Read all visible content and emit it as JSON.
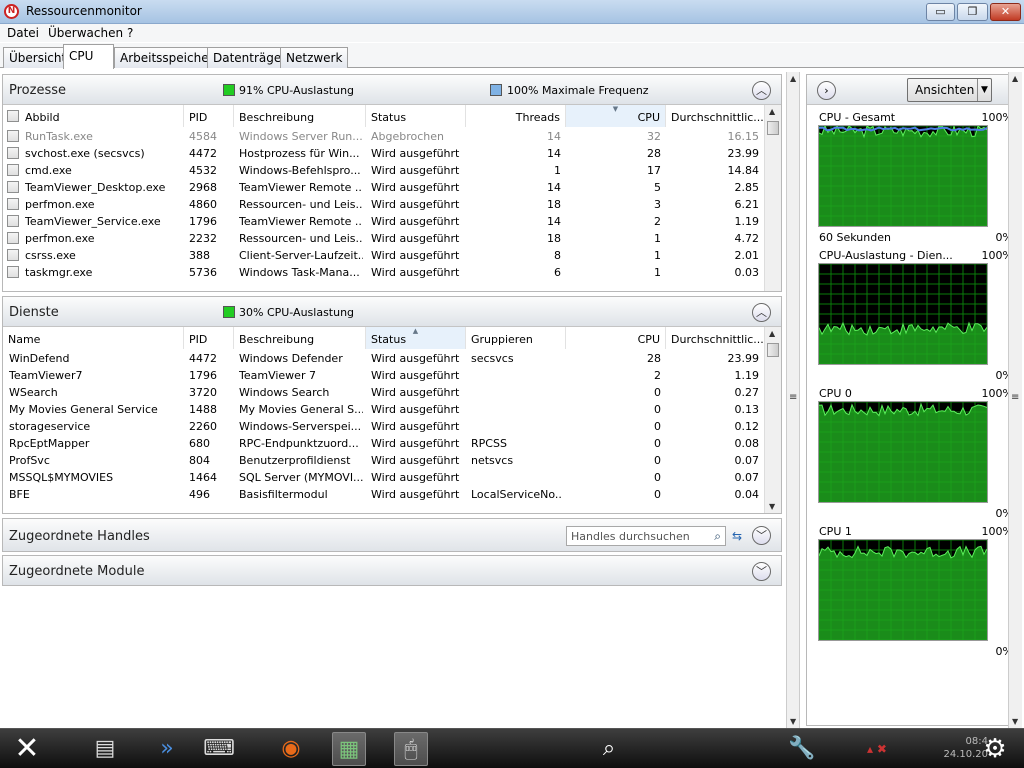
{
  "window": {
    "title": "Ressourcenmonitor",
    "minimize": "▭",
    "restore": "❐",
    "close": "✕"
  },
  "menu": [
    "Datei",
    "Überwachen",
    "?"
  ],
  "tabs": [
    "Übersicht",
    "CPU",
    "Arbeitsspeicher",
    "Datenträger",
    "Netzwerk"
  ],
  "prozesse": {
    "title": "Prozesse",
    "legend1": "91% CPU-Auslastung",
    "legend1_color": "#22cc22",
    "legend2": "100% Maximale Frequenz",
    "legend2_color": "#7fb2e5",
    "columns": [
      "Abbild",
      "PID",
      "Beschreibung",
      "Status",
      "Threads",
      "CPU",
      "Durchschnittlic..."
    ],
    "rows": [
      {
        "name": "RunTask.exe",
        "pid": "4584",
        "desc": "Windows Server Run...",
        "status": "Abgebrochen",
        "threads": "14",
        "cpu": "32",
        "avg": "16.15"
      },
      {
        "name": "svchost.exe (secsvcs)",
        "pid": "4472",
        "desc": "Hostprozess für Win...",
        "status": "Wird ausgeführt",
        "threads": "14",
        "cpu": "28",
        "avg": "23.99"
      },
      {
        "name": "cmd.exe",
        "pid": "4532",
        "desc": "Windows-Befehlspro...",
        "status": "Wird ausgeführt",
        "threads": "1",
        "cpu": "17",
        "avg": "14.84"
      },
      {
        "name": "TeamViewer_Desktop.exe",
        "pid": "2968",
        "desc": "TeamViewer Remote ...",
        "status": "Wird ausgeführt",
        "threads": "14",
        "cpu": "5",
        "avg": "2.85"
      },
      {
        "name": "perfmon.exe",
        "pid": "4860",
        "desc": "Ressourcen- und Leis...",
        "status": "Wird ausgeführt",
        "threads": "18",
        "cpu": "3",
        "avg": "6.21"
      },
      {
        "name": "TeamViewer_Service.exe",
        "pid": "1796",
        "desc": "TeamViewer Remote ...",
        "status": "Wird ausgeführt",
        "threads": "14",
        "cpu": "2",
        "avg": "1.19"
      },
      {
        "name": "perfmon.exe",
        "pid": "2232",
        "desc": "Ressourcen- und Leis...",
        "status": "Wird ausgeführt",
        "threads": "18",
        "cpu": "1",
        "avg": "4.72"
      },
      {
        "name": "csrss.exe",
        "pid": "388",
        "desc": "Client-Server-Laufzeit...",
        "status": "Wird ausgeführt",
        "threads": "8",
        "cpu": "1",
        "avg": "2.01"
      },
      {
        "name": "taskmgr.exe",
        "pid": "5736",
        "desc": "Windows Task-Mana...",
        "status": "Wird ausgeführt",
        "threads": "6",
        "cpu": "1",
        "avg": "0.03"
      }
    ]
  },
  "dienste": {
    "title": "Dienste",
    "legend1": "30% CPU-Auslastung",
    "legend1_color": "#22cc22",
    "columns": [
      "Name",
      "PID",
      "Beschreibung",
      "Status",
      "Gruppieren",
      "CPU",
      "Durchschnittlic..."
    ],
    "rows": [
      {
        "name": "WinDefend",
        "pid": "4472",
        "desc": "Windows Defender",
        "status": "Wird ausgeführt",
        "group": "secsvcs",
        "cpu": "28",
        "avg": "23.99"
      },
      {
        "name": "TeamViewer7",
        "pid": "1796",
        "desc": "TeamViewer 7",
        "status": "Wird ausgeführt",
        "group": "",
        "cpu": "2",
        "avg": "1.19"
      },
      {
        "name": "WSearch",
        "pid": "3720",
        "desc": "Windows Search",
        "status": "Wird ausgeführt",
        "group": "",
        "cpu": "0",
        "avg": "0.27"
      },
      {
        "name": "My Movies General Service",
        "pid": "1488",
        "desc": "My Movies General S...",
        "status": "Wird ausgeführt",
        "group": "",
        "cpu": "0",
        "avg": "0.13"
      },
      {
        "name": "storageservice",
        "pid": "2260",
        "desc": "Windows-Serverspei...",
        "status": "Wird ausgeführt",
        "group": "",
        "cpu": "0",
        "avg": "0.12"
      },
      {
        "name": "RpcEptMapper",
        "pid": "680",
        "desc": "RPC-Endpunktzuord...",
        "status": "Wird ausgeführt",
        "group": "RPCSS",
        "cpu": "0",
        "avg": "0.08"
      },
      {
        "name": "ProfSvc",
        "pid": "804",
        "desc": "Benutzerprofildienst",
        "status": "Wird ausgeführt",
        "group": "netsvcs",
        "cpu": "0",
        "avg": "0.07"
      },
      {
        "name": "MSSQL$MYMOVIES",
        "pid": "1464",
        "desc": "SQL Server (MYMOVI...",
        "status": "Wird ausgeführt",
        "group": "",
        "cpu": "0",
        "avg": "0.07"
      },
      {
        "name": "BFE",
        "pid": "496",
        "desc": "Basisfiltermodul",
        "status": "Wird ausgeführt",
        "group": "LocalServiceNo...",
        "cpu": "0",
        "avg": "0.04"
      }
    ]
  },
  "handles": {
    "title": "Zugeordnete Handles",
    "search_placeholder": "Handles durchsuchen"
  },
  "module": {
    "title": "Zugeordnete Module"
  },
  "right_panel": {
    "view_button": "Ansichten",
    "graphs": [
      {
        "label": "CPU - Gesamt",
        "top_pct": "100%",
        "footer": "60 Sekunden",
        "bottom_pct": "0%",
        "level": 0.95,
        "secondary_level": 0.97
      },
      {
        "label": "CPU-Auslastung - Dien...",
        "top_pct": "100%",
        "footer": "",
        "bottom_pct": "0%",
        "level": 0.35,
        "secondary_level": null
      },
      {
        "label": "CPU 0",
        "top_pct": "100%",
        "footer": "",
        "bottom_pct": "0%",
        "level": 0.92,
        "secondary_level": null
      },
      {
        "label": "CPU 1",
        "top_pct": "100%",
        "footer": "",
        "bottom_pct": "0%",
        "level": 0.88,
        "secondary_level": null
      }
    ]
  },
  "taskbar": {
    "icons": [
      "close-icon",
      "server-manager-icon",
      "powershell-icon",
      "keyboard-icon",
      "firefox-icon",
      "network-icon",
      "mouse-icon",
      "search-icon",
      "tools-icon",
      "settings-icon"
    ],
    "clock_time": "08:4",
    "clock_date": "24.10.20"
  }
}
